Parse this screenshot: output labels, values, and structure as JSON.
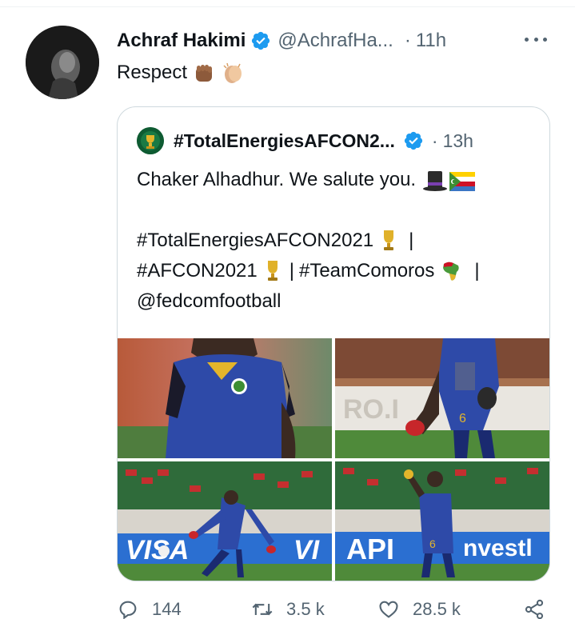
{
  "tweet": {
    "author_name": "Achraf Hakimi",
    "handle": "@AchrafHa...",
    "separator": "·",
    "time": "11h",
    "text": "Respect",
    "emojis": [
      "fist-medium-dark-icon",
      "clapping-hands-medium-light-icon"
    ]
  },
  "quoted_tweet": {
    "author_name": "#TotalEnergiesAFCON2...",
    "separator": "·",
    "time": "13h",
    "line1": "Chaker Alhadhur. We salute you.",
    "line2_tag": "#TotalEnergiesAFCON2021",
    "line3_tag1": "#AFCON2021",
    "line3_tag2": "#TeamComoros",
    "line4_mention": "@fedcomfootball",
    "pipe": "|",
    "photos": [
      {
        "name": "photo-player-closeup",
        "overlay_text": ""
      },
      {
        "name": "photo-player-goalkeeper-gloves",
        "overlay_text": "RO.I"
      },
      {
        "name": "photo-player-running-stadium",
        "overlay_text": "VISA"
      },
      {
        "name": "photo-player-celebrating",
        "overlay_text": "API"
      }
    ]
  },
  "actions": {
    "reply_count": "144",
    "retweet_count": "3.5 k",
    "like_count": "28.5 k"
  },
  "colors": {
    "verified": "#1d9bf0",
    "secondary_text": "#536471",
    "border": "#cfd9de",
    "jersey_blue": "#2e4aa8"
  }
}
